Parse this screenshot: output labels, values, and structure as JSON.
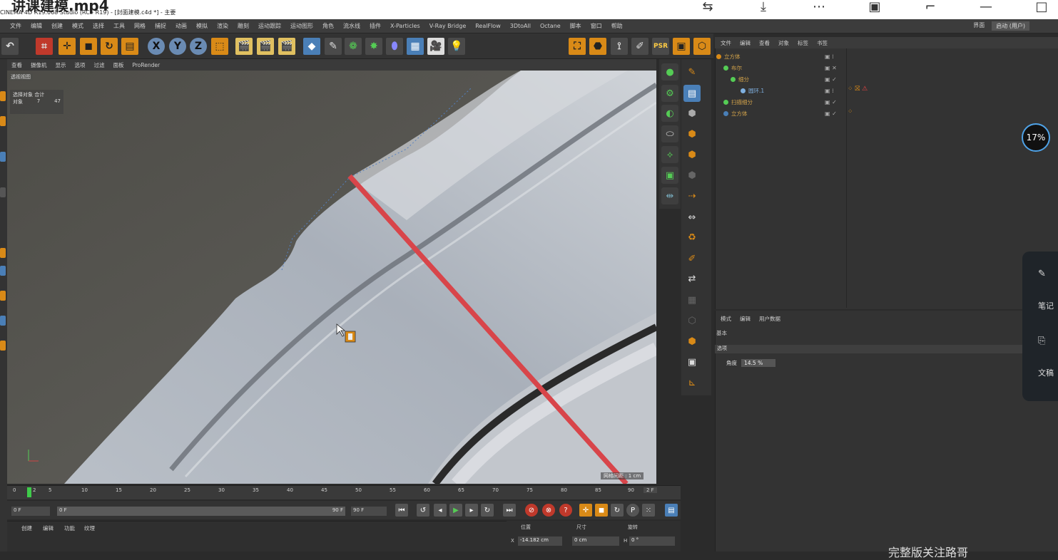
{
  "video_title": "讲课建模.mp4",
  "app_title": "CINEMA 4D R19.068 Studio (RC - R19) - [封面建模.c4d *] - 主要",
  "menu": [
    "文件",
    "编辑",
    "创建",
    "模式",
    "选择",
    "工具",
    "网格",
    "捕捉",
    "动画",
    "模拟",
    "渲染",
    "雕刻",
    "运动跟踪",
    "运动图形",
    "角色",
    "流水线",
    "插件",
    "X-Particles",
    "V-Ray Bridge",
    "RealFlow",
    "3DtoAll",
    "Octane",
    "脚本",
    "窗口",
    "帮助"
  ],
  "menu_right": {
    "layout_label": "界面",
    "layout_value": "启动 (用户)"
  },
  "viewport_menu": [
    "查看",
    "摄像机",
    "显示",
    "选项",
    "过滤",
    "面板",
    "ProRender"
  ],
  "viewport_label": "透视视图",
  "stats": {
    "header": "选择对象 合计",
    "row_label": "对象",
    "row_value1": "7",
    "row_value2": "47"
  },
  "grid_label": "网格间距 : 1 cm",
  "object_manager": {
    "menu": [
      "文件",
      "编辑",
      "查看",
      "对象",
      "标签",
      "书签"
    ],
    "objects": [
      {
        "name": "立方体",
        "color": "#d98a17"
      },
      {
        "name": "布尔",
        "color": "#d98a17"
      },
      {
        "name": "细分",
        "color": "#d98a17"
      },
      {
        "name": "圆环.1",
        "color": "#7fb0e0"
      },
      {
        "name": "扫描细分",
        "color": "#d98a17"
      },
      {
        "name": "立方体",
        "color": "#d98a17"
      }
    ]
  },
  "attribute_manager": {
    "menu": [
      "模式",
      "编辑",
      "用户数据"
    ],
    "subtitle": "基本",
    "tab": "选项",
    "field_label": "角度",
    "field_value": "14.5 %"
  },
  "hud_percent": "17%",
  "side_widget": {
    "item1": "笔记",
    "item2": "文稿"
  },
  "timeline": {
    "ticks": [
      "0",
      "2",
      "5",
      "10",
      "15",
      "20",
      "25",
      "30",
      "35",
      "40",
      "45",
      "50",
      "55",
      "60",
      "65",
      "70",
      "75",
      "80",
      "85",
      "90"
    ],
    "end_label": "2 F",
    "current_frame": "0 F",
    "min_frame": "0 F",
    "max_frame": "90 F",
    "end_frame": "90 F"
  },
  "bottom_menu": [
    "创建",
    "编辑",
    "功能",
    "纹理"
  ],
  "coordinates": {
    "headers": [
      "位置",
      "尺寸",
      "旋转"
    ],
    "x_label": "X",
    "x_pos": "-14.182 cm",
    "x_size": "0 cm",
    "h_label": "H",
    "h_rot": "0 °"
  },
  "watermark": "完整版关注路哥",
  "colors": {
    "accent_orange": "#d98a17",
    "accent_blue": "#4a7fb7",
    "edge_red": "#d8454a"
  }
}
